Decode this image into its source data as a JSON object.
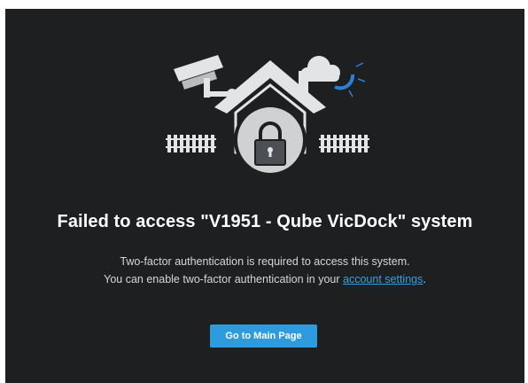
{
  "error": {
    "title": "Failed to access \"V1951 - Qube VicDock\" system",
    "line1": "Two-factor authentication is required to access this system.",
    "line2_prefix": "You can enable two-factor authentication in your ",
    "link_label": "account settings",
    "line2_suffix": "."
  },
  "actions": {
    "main_page_label": "Go to Main Page"
  },
  "illustration": {
    "icons": [
      "security-camera-icon",
      "house-icon",
      "padlock-icon",
      "cloud-icon",
      "moon-icon",
      "fence-icon"
    ]
  },
  "colors": {
    "background": "#1e1f20",
    "primary_button": "#2f9bdf",
    "link": "#2fa2e6",
    "illustration": "#e3e4e5",
    "moon": "#2f7fd8"
  }
}
